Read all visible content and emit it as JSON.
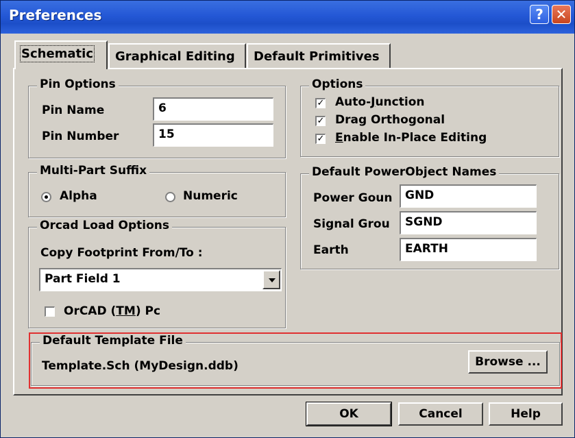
{
  "window": {
    "title": "Preferences",
    "help_glyph": "?",
    "close_glyph": "✕"
  },
  "tabs": [
    {
      "label": "Schematic"
    },
    {
      "label": "Graphical Editing"
    },
    {
      "label": "Default Primitives"
    }
  ],
  "pin_options": {
    "legend": "Pin Options",
    "pin_name_label": "Pin Name",
    "pin_name_value": "6",
    "pin_number_label": "Pin Number",
    "pin_number_value": "15"
  },
  "options": {
    "legend": "Options",
    "auto_junction": {
      "label": "Auto-Junction",
      "checked": true
    },
    "drag_orthogonal": {
      "label": "Drag Orthogonal",
      "checked": true
    },
    "enable_inplace": {
      "label": "Enable In-Place Editing",
      "checked": true
    }
  },
  "multi_part_suffix": {
    "legend": "Multi-Part Suffix",
    "alpha_label": "Alpha",
    "numeric_label": "Numeric",
    "selected": "Alpha"
  },
  "default_power_names": {
    "legend": "Default PowerObject Names",
    "power_ground_label": "Power Goun",
    "power_ground_value": "GND",
    "signal_ground_label": "Signal Grou",
    "signal_ground_value": "SGND",
    "earth_label": "Earth",
    "earth_value": "EARTH"
  },
  "orcad_load_options": {
    "legend": "Orcad Load Options",
    "copy_footprint_label": "Copy Footprint From/To :",
    "copy_footprint_value": "Part Field 1",
    "orcad_ports_label": "OrCAD (TM) Pc",
    "orcad_ports_checked": false
  },
  "default_template": {
    "legend": "Default Template File",
    "file_value": "Template.Sch (MyDesign.ddb)",
    "browse_label": "Browse ..."
  },
  "buttons": {
    "ok": "OK",
    "cancel": "Cancel",
    "help": "Help"
  },
  "colors": {
    "title_blue": "#2458d6",
    "dialog_gray": "#d4d0c8",
    "highlight_red": "#e03030"
  },
  "check_glyph": "✓"
}
